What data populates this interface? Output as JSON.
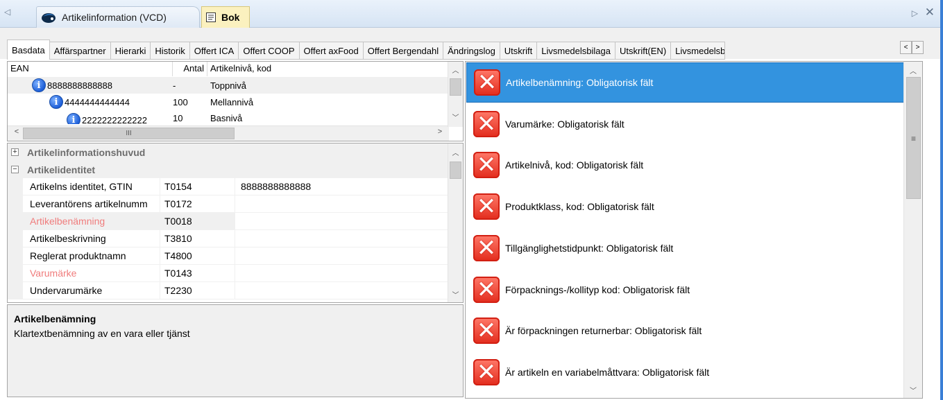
{
  "doc_tabs": [
    {
      "label": "Artikelinformation (VCD)"
    },
    {
      "label": "Bok"
    }
  ],
  "tabs": [
    "Basdata",
    "Affärspartner",
    "Hierarki",
    "Historik",
    "Offert ICA",
    "Offert COOP",
    "Offert axFood",
    "Offert Bergendahl",
    "Ändringslog",
    "Utskrift",
    "Livsmedelsbilaga",
    "Utskrift(EN)",
    "Livsmedelsb"
  ],
  "hierarchy": {
    "headers": [
      "EAN",
      "Antal",
      "Artikelnivå, kod"
    ],
    "rows": [
      {
        "ean": "8888888888888",
        "antal": "-",
        "niva": "Toppnivå"
      },
      {
        "ean": "4444444444444",
        "antal": "100",
        "niva": "Mellannivå"
      },
      {
        "ean": "2222222222222",
        "antal": "10",
        "niva": "Basnivå"
      }
    ],
    "scroll_grip": "III"
  },
  "properties": {
    "categories": [
      {
        "label": "Artikelinformationshuvud",
        "expander": "+"
      },
      {
        "label": "Artikelidentitet",
        "expander": "−"
      }
    ],
    "rows": [
      {
        "name": "Artikelns identitet, GTIN",
        "code": "T0154",
        "value": "8888888888888"
      },
      {
        "name": "Leverantörens artikelnumm",
        "code": "T0172",
        "value": ""
      },
      {
        "name": "Artikelbenämning",
        "code": "T0018",
        "value": ""
      },
      {
        "name": "Artikelbeskrivning",
        "code": "T3810",
        "value": ""
      },
      {
        "name": "Reglerat produktnamn",
        "code": "T4800",
        "value": ""
      },
      {
        "name": "Varumärke",
        "code": "T0143",
        "value": ""
      },
      {
        "name": "Undervarumärke",
        "code": "T2230",
        "value": ""
      }
    ]
  },
  "description": {
    "title": "Artikelbenämning",
    "text": "Klartextbenämning av en vara eller tjänst"
  },
  "errors": [
    "Artikelbenämning: Obligatorisk fält",
    "Varumärke: Obligatorisk fält",
    "Artikelnivå, kod: Obligatorisk fält",
    "Produktklass, kod: Obligatorisk fält",
    "Tillgänglighetstidpunkt: Obligatorisk fält",
    "Förpacknings-/kollityp kod: Obligatorisk fält",
    "Är förpackningen returnerbar: Obligatorisk fält",
    "Är artikeln en variabelmåttvara: Obligatorisk fält"
  ],
  "colors": {
    "selection": "#3393df",
    "required_field": "#f07c7c",
    "active_doc_tab": "#fbf1bf"
  }
}
